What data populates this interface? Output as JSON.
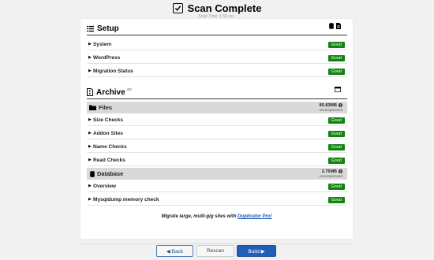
{
  "header": {
    "title": "Scan Complete",
    "subtitle": "Scan Time: 1.65 sec."
  },
  "setup": {
    "title": "Setup",
    "rows": [
      {
        "label": "System",
        "status": "Good"
      },
      {
        "label": "WordPress",
        "status": "Good"
      },
      {
        "label": "Migration Status",
        "status": "Good"
      }
    ]
  },
  "archive": {
    "title": "Archive",
    "format": "zip",
    "files": {
      "label": "Files",
      "size": "85.83MB",
      "note": "uncompressed",
      "rows": [
        {
          "label": "Size Checks",
          "status": "Good"
        },
        {
          "label": "Addon Sites",
          "status": "Good"
        },
        {
          "label": "Name Checks",
          "status": "Good"
        },
        {
          "label": "Read Checks",
          "status": "Good"
        }
      ]
    },
    "database": {
      "label": "Database",
      "size": "2.75MB",
      "note": "uncompressed",
      "rows": [
        {
          "label": "Overview",
          "status": "Good"
        },
        {
          "label": "Mysqldump memory check",
          "status": "Good"
        }
      ]
    }
  },
  "promo": {
    "text": "Migrate large, multi-gig sites with ",
    "link": "Duplicator Pro!"
  },
  "buttons": {
    "back": "◀ Back",
    "rescan": "Rescan",
    "build": "Build ▶"
  },
  "colors": {
    "good_badge": "#128312",
    "build_button": "#1f5fb7",
    "link": "#1a56b8"
  }
}
